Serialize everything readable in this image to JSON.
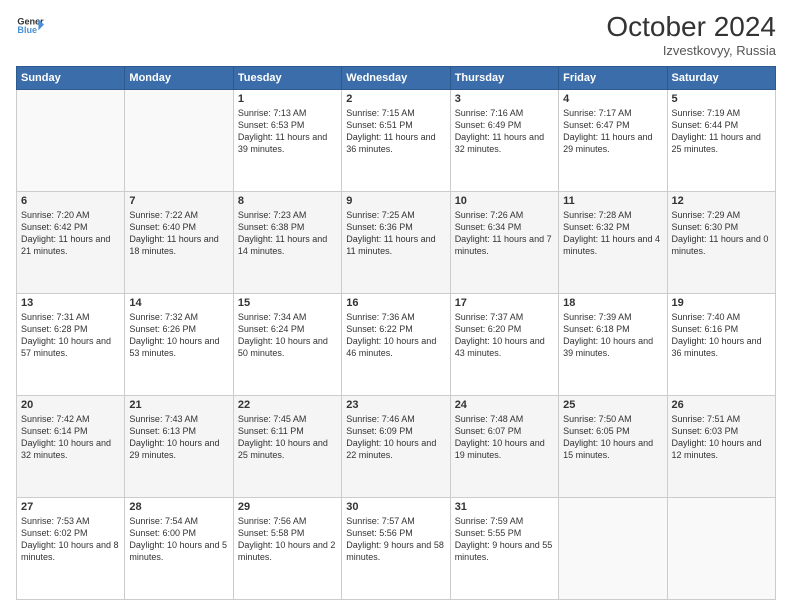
{
  "header": {
    "logo_line1": "General",
    "logo_line2": "Blue",
    "month": "October 2024",
    "location": "Izvestkovyy, Russia"
  },
  "days_of_week": [
    "Sunday",
    "Monday",
    "Tuesday",
    "Wednesday",
    "Thursday",
    "Friday",
    "Saturday"
  ],
  "weeks": [
    [
      {
        "day": "",
        "info": ""
      },
      {
        "day": "",
        "info": ""
      },
      {
        "day": "1",
        "info": "Sunrise: 7:13 AM\nSunset: 6:53 PM\nDaylight: 11 hours and 39 minutes."
      },
      {
        "day": "2",
        "info": "Sunrise: 7:15 AM\nSunset: 6:51 PM\nDaylight: 11 hours and 36 minutes."
      },
      {
        "day": "3",
        "info": "Sunrise: 7:16 AM\nSunset: 6:49 PM\nDaylight: 11 hours and 32 minutes."
      },
      {
        "day": "4",
        "info": "Sunrise: 7:17 AM\nSunset: 6:47 PM\nDaylight: 11 hours and 29 minutes."
      },
      {
        "day": "5",
        "info": "Sunrise: 7:19 AM\nSunset: 6:44 PM\nDaylight: 11 hours and 25 minutes."
      }
    ],
    [
      {
        "day": "6",
        "info": "Sunrise: 7:20 AM\nSunset: 6:42 PM\nDaylight: 11 hours and 21 minutes."
      },
      {
        "day": "7",
        "info": "Sunrise: 7:22 AM\nSunset: 6:40 PM\nDaylight: 11 hours and 18 minutes."
      },
      {
        "day": "8",
        "info": "Sunrise: 7:23 AM\nSunset: 6:38 PM\nDaylight: 11 hours and 14 minutes."
      },
      {
        "day": "9",
        "info": "Sunrise: 7:25 AM\nSunset: 6:36 PM\nDaylight: 11 hours and 11 minutes."
      },
      {
        "day": "10",
        "info": "Sunrise: 7:26 AM\nSunset: 6:34 PM\nDaylight: 11 hours and 7 minutes."
      },
      {
        "day": "11",
        "info": "Sunrise: 7:28 AM\nSunset: 6:32 PM\nDaylight: 11 hours and 4 minutes."
      },
      {
        "day": "12",
        "info": "Sunrise: 7:29 AM\nSunset: 6:30 PM\nDaylight: 11 hours and 0 minutes."
      }
    ],
    [
      {
        "day": "13",
        "info": "Sunrise: 7:31 AM\nSunset: 6:28 PM\nDaylight: 10 hours and 57 minutes."
      },
      {
        "day": "14",
        "info": "Sunrise: 7:32 AM\nSunset: 6:26 PM\nDaylight: 10 hours and 53 minutes."
      },
      {
        "day": "15",
        "info": "Sunrise: 7:34 AM\nSunset: 6:24 PM\nDaylight: 10 hours and 50 minutes."
      },
      {
        "day": "16",
        "info": "Sunrise: 7:36 AM\nSunset: 6:22 PM\nDaylight: 10 hours and 46 minutes."
      },
      {
        "day": "17",
        "info": "Sunrise: 7:37 AM\nSunset: 6:20 PM\nDaylight: 10 hours and 43 minutes."
      },
      {
        "day": "18",
        "info": "Sunrise: 7:39 AM\nSunset: 6:18 PM\nDaylight: 10 hours and 39 minutes."
      },
      {
        "day": "19",
        "info": "Sunrise: 7:40 AM\nSunset: 6:16 PM\nDaylight: 10 hours and 36 minutes."
      }
    ],
    [
      {
        "day": "20",
        "info": "Sunrise: 7:42 AM\nSunset: 6:14 PM\nDaylight: 10 hours and 32 minutes."
      },
      {
        "day": "21",
        "info": "Sunrise: 7:43 AM\nSunset: 6:13 PM\nDaylight: 10 hours and 29 minutes."
      },
      {
        "day": "22",
        "info": "Sunrise: 7:45 AM\nSunset: 6:11 PM\nDaylight: 10 hours and 25 minutes."
      },
      {
        "day": "23",
        "info": "Sunrise: 7:46 AM\nSunset: 6:09 PM\nDaylight: 10 hours and 22 minutes."
      },
      {
        "day": "24",
        "info": "Sunrise: 7:48 AM\nSunset: 6:07 PM\nDaylight: 10 hours and 19 minutes."
      },
      {
        "day": "25",
        "info": "Sunrise: 7:50 AM\nSunset: 6:05 PM\nDaylight: 10 hours and 15 minutes."
      },
      {
        "day": "26",
        "info": "Sunrise: 7:51 AM\nSunset: 6:03 PM\nDaylight: 10 hours and 12 minutes."
      }
    ],
    [
      {
        "day": "27",
        "info": "Sunrise: 7:53 AM\nSunset: 6:02 PM\nDaylight: 10 hours and 8 minutes."
      },
      {
        "day": "28",
        "info": "Sunrise: 7:54 AM\nSunset: 6:00 PM\nDaylight: 10 hours and 5 minutes."
      },
      {
        "day": "29",
        "info": "Sunrise: 7:56 AM\nSunset: 5:58 PM\nDaylight: 10 hours and 2 minutes."
      },
      {
        "day": "30",
        "info": "Sunrise: 7:57 AM\nSunset: 5:56 PM\nDaylight: 9 hours and 58 minutes."
      },
      {
        "day": "31",
        "info": "Sunrise: 7:59 AM\nSunset: 5:55 PM\nDaylight: 9 hours and 55 minutes."
      },
      {
        "day": "",
        "info": ""
      },
      {
        "day": "",
        "info": ""
      }
    ]
  ]
}
